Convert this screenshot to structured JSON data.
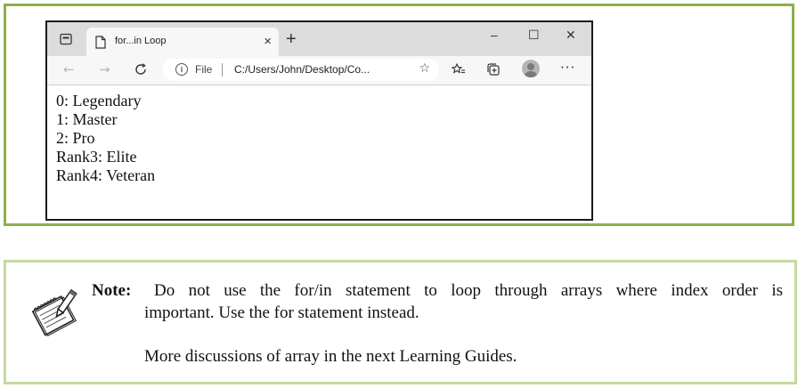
{
  "browser": {
    "tab_title": "for...in Loop",
    "tab_close": "×",
    "new_tab": "+",
    "window_buttons": {
      "minimize": "–",
      "maximize": "☐",
      "close": "✕"
    },
    "address": {
      "file_label": "File",
      "url": "C:/Users/John/Desktop/Co..."
    },
    "icons": [
      "tab-actions-icon",
      "page-icon",
      "back-arrow-icon",
      "forward-arrow-icon",
      "refresh-icon",
      "info-icon",
      "favorite-star-icon",
      "favorites-icon",
      "collections-icon",
      "profile-avatar",
      "more-icon"
    ]
  },
  "output_lines": [
    "0: Legendary",
    "1: Master",
    "2: Pro",
    "Rank3: Elite",
    "Rank4: Veteran"
  ],
  "note": {
    "label": "Note:",
    "line1": "Do not use the for/in statement to loop through arrays where index order is",
    "line2": "important. Use the for statement instead.",
    "line3": "More discussions of array in the next Learning Guides."
  },
  "colors": {
    "frame_border": "#8cb04a",
    "note_border": "#c5d9a0"
  }
}
